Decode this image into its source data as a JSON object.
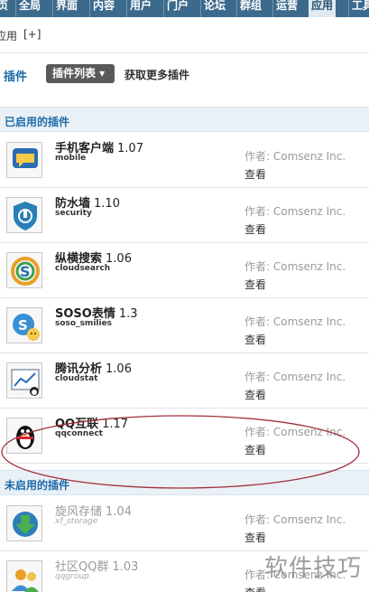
{
  "nav": {
    "tabs": [
      {
        "label": "页"
      },
      {
        "label": "全局"
      },
      {
        "label": "界面"
      },
      {
        "label": "内容"
      },
      {
        "label": "用户"
      },
      {
        "label": "门户"
      },
      {
        "label": "论坛"
      },
      {
        "label": "群组"
      },
      {
        "label": "运营"
      },
      {
        "label": "应用"
      },
      {
        "label": "工具"
      }
    ]
  },
  "subbar": {
    "label": "应用",
    "expand": "[+]"
  },
  "plugin_header": {
    "title": "插件",
    "dropdown": "插件列表 ▾",
    "more_link": "获取更多插件"
  },
  "sections": {
    "enabled": "已启用的插件",
    "disabled": "未启用的插件"
  },
  "enabled_plugins": [
    {
      "name": "手机客户端",
      "version": "1.07",
      "ident": "mobile",
      "author": "作者: Comsenz Inc.",
      "view": "查看",
      "icon": "mobile-chat-icon"
    },
    {
      "name": "防水墙",
      "version": "1.10",
      "ident": "security",
      "author": "作者: Comsenz Inc.",
      "view": "查看",
      "icon": "security-shield-icon"
    },
    {
      "name": "纵横搜索",
      "version": "1.06",
      "ident": "cloudsearch",
      "author": "作者: Comsenz Inc.",
      "view": "查看",
      "icon": "search-s-icon"
    },
    {
      "name": "SOSO表情",
      "version": "1.3",
      "ident": "soso_smilies",
      "author": "作者: Comsenz Inc.",
      "view": "查看",
      "icon": "smiley-search-icon"
    },
    {
      "name": "腾讯分析",
      "version": "1.06",
      "ident": "cloudstat",
      "author": "作者: Comsenz Inc.",
      "view": "查看",
      "icon": "analytics-chart-icon"
    },
    {
      "name": "QQ互联",
      "version": "1.17",
      "ident": "qqconnect",
      "author": "作者: Comsenz Inc.",
      "view": "查看",
      "icon": "qq-penguin-icon"
    }
  ],
  "disabled_plugins": [
    {
      "name": "旋风存储",
      "version": "1.04",
      "ident": "xf_storage",
      "author": "作者: Comsenz Inc.",
      "view": "查看",
      "icon": "download-arrow-icon"
    },
    {
      "name": "社区QQ群",
      "version": "1.03",
      "ident": "qqgroup",
      "author": "作者: Comsenz Inc.",
      "view": "查看",
      "icon": "qq-group-icon"
    }
  ],
  "watermark": "软件技巧",
  "colors": {
    "nav_bg": "#3c6a8d",
    "section_bg": "#eaf1f6",
    "section_text": "#1e6aa8",
    "annotation_ellipse": "#a0303a"
  }
}
